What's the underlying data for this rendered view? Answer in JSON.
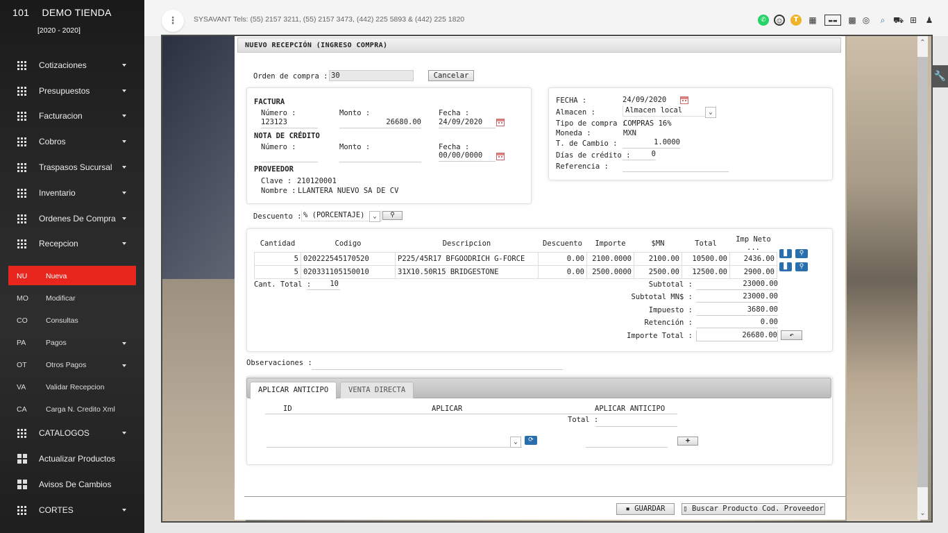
{
  "sidebar": {
    "company_number": "101",
    "company_name": "DEMO TIENDA",
    "years": "[2020 - 2020]",
    "menu": [
      {
        "label": "Cotizaciones"
      },
      {
        "label": "Presupuestos"
      },
      {
        "label": "Facturacion"
      },
      {
        "label": "Cobros"
      },
      {
        "label": "Traspasos Sucursal"
      },
      {
        "label": "Inventario"
      },
      {
        "label": "Ordenes De Compra"
      },
      {
        "label": "Recepcion"
      }
    ],
    "submenu": [
      {
        "abbr": "NU",
        "label": "Nueva"
      },
      {
        "abbr": "MO",
        "label": "Modificar"
      },
      {
        "abbr": "CO",
        "label": "Consultas"
      },
      {
        "abbr": "PA",
        "label": "Pagos"
      },
      {
        "abbr": "OT",
        "label": "Otros Pagos"
      },
      {
        "abbr": "VA",
        "label": "Validar Recepcion"
      },
      {
        "abbr": "CA",
        "label": "Carga N. Credito Xml"
      }
    ],
    "bottom_menu": [
      {
        "label": "CATALOGOS"
      },
      {
        "label": "Actualizar Productos"
      },
      {
        "label": "Avisos De Cambios"
      },
      {
        "label": "CORTES"
      }
    ]
  },
  "topbar": {
    "menu_icon": "⋮",
    "info": "SYSAVANT Tels: (55) 2157 3211, (55) 2157 3473, (442) 225 5893 & (442) 225 1820",
    "icons": [
      "whatsapp-icon",
      "support-icon",
      "user-t-icon",
      "grid-icon",
      "keyboard-icon",
      "qr-icon",
      "target-icon",
      "search-doc-icon",
      "car-icon",
      "window-icon",
      "user-icon"
    ]
  },
  "form": {
    "title": "NUEVO RECEPCIÓN (INGRESO COMPRA)",
    "orden_compra_label": "Orden de compra :",
    "orden_compra_value": "30",
    "cancel_label": "Cancelar",
    "factura": {
      "heading": "FACTURA",
      "numero_label": "Número :",
      "numero_value": "123123",
      "monto_label": "Monto :",
      "monto_value": "26680.00",
      "fecha_label": "Fecha :",
      "fecha_value": "24/09/2020"
    },
    "nota": {
      "heading": "NOTA DE CRÉDITO",
      "numero_label": "Número :",
      "numero_value": "",
      "monto_label": "Monto :",
      "monto_value": "",
      "fecha_label": "Fecha :",
      "fecha_value": "00/00/0000"
    },
    "proveedor": {
      "heading": "PROVEEDOR",
      "clave_label": "Clave :",
      "clave_value": "210120001",
      "nombre_label": "Nombre :",
      "nombre_value": "LLANTERA NUEVO SA DE CV"
    },
    "right": {
      "fecha_label": "FECHA :",
      "fecha_value": "24/09/2020",
      "almacen_label": "Almacen :",
      "almacen_value": "Almacen local",
      "tipo_label": "Tipo de compra :",
      "tipo_value": "COMPRAS 16%",
      "moneda_label": "Moneda :",
      "moneda_value": "MXN",
      "cambio_label": "T. de Cambio :",
      "cambio_value": "1.0000",
      "dias_label": "Días de crédito :",
      "dias_value": "0",
      "referencia_label": "Referencia :",
      "referencia_value": ""
    },
    "descuento_label": "Descuento :",
    "descuento_value": "% (PORCENTAJE)",
    "table": {
      "headers": [
        "Cantidad",
        "Codigo",
        "Descripcion",
        "Descuento",
        "Importe",
        "$MN",
        "Total",
        "Imp Neto ..."
      ],
      "rows": [
        [
          "5",
          "020222545170520",
          "P225/45R17 BFGOODRICH G-FORCE",
          "0.00",
          "2100.0000",
          "2100.00",
          "10500.00",
          "2436.00"
        ],
        [
          "5",
          "020331105150010",
          "31X10.50R15 BRIDGESTONE",
          "0.00",
          "2500.0000",
          "2500.00",
          "12500.00",
          "2900.00"
        ]
      ]
    },
    "cant_total_label": "Cant. Total :",
    "cant_total_value": "10",
    "totals": {
      "subtotal_label": "Subtotal :",
      "subtotal_value": "23000.00",
      "subtotal_mn_label": "Subtotal MN$ :",
      "subtotal_mn_value": "23000.00",
      "impuesto_label": "Impuesto :",
      "impuesto_value": "3680.00",
      "retencion_label": "Retención :",
      "retencion_value": "0.00",
      "importe_total_label": "Importe Total :",
      "importe_total_value": "26680.00"
    },
    "observaciones_label": "Observaciones :",
    "tabs": [
      "APLICAR ANTICIPO",
      "VENTA DIRECTA"
    ],
    "anticipo": {
      "col_id": "ID",
      "col_aplicar": "APLICAR",
      "col_aplicar_anticipo": "APLICAR ANTICIPO",
      "total_label": "Total :"
    },
    "guardar_label": "GUARDAR",
    "buscar_label": "Buscar Producto Cod. Proveedor"
  }
}
